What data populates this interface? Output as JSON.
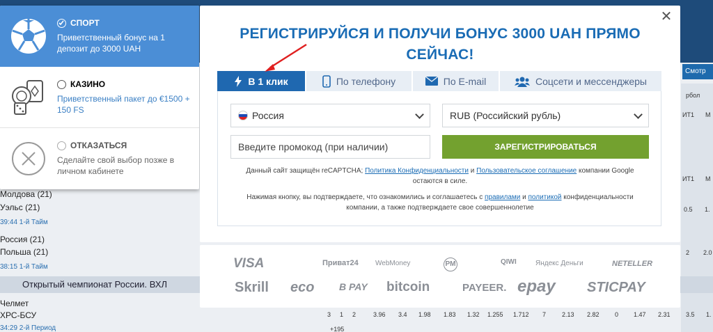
{
  "background": {
    "right_tab": "Смотр",
    "rows": [
      {
        "team": "Молдова (21)"
      },
      {
        "team": "Уэльс (21)"
      },
      {
        "time": "39:44 1-й Тайм"
      },
      {
        "team": "Россия (21)"
      },
      {
        "team": "Польша (21)"
      },
      {
        "time": "38:15 1-й Тайм"
      },
      {
        "league": "Открытый чемпионат России. ВХЛ"
      },
      {
        "team": "Челмет"
      },
      {
        "team": "ХРС-БСУ"
      },
      {
        "time": "34:29 2-й Период"
      }
    ],
    "odds": [
      "3",
      "1",
      "2",
      "3.96",
      "3.4",
      "1.98",
      "1.83",
      "1.32",
      "1.255",
      "1.712",
      "7",
      "2.13",
      "2.82",
      "0",
      "1.47",
      "2.31",
      "3.5",
      "1."
    ],
    "more": "+195",
    "col_labels": [
      "ИТ1",
      "М",
      "ИТ1",
      "М",
      "ИТ1",
      "М",
      "рбол"
    ],
    "side_vals": [
      "0.5",
      "1.",
      "2",
      "2.0"
    ]
  },
  "bonus_panel": {
    "options": [
      {
        "title": "СПОРТ",
        "desc": "Приветственный бонус на 1 депозит до 3000 UAH",
        "selected": true
      },
      {
        "title": "КАЗИНО",
        "desc": "Приветственный пакет до €1500 + 150 FS",
        "selected": false
      },
      {
        "title": "ОТКАЗАТЬСЯ",
        "desc": "Сделайте свой выбор позже в личном кабинете",
        "selected": false
      }
    ]
  },
  "modal": {
    "headline": "РЕГИСТРИРУЙСЯ И ПОЛУЧИ БОНУС 3000 UAH ПРЯМО СЕЙЧАС!",
    "tabs": [
      {
        "label": "В 1 клик",
        "icon": "lightning-icon",
        "active": true
      },
      {
        "label": "По телефону",
        "icon": "phone-icon"
      },
      {
        "label": "По E-mail",
        "icon": "envelope-icon"
      },
      {
        "label": "Соцсети и мессенджеры",
        "icon": "people-icon"
      }
    ],
    "country": "Россия",
    "currency": "RUB (Российский рубль)",
    "promo_placeholder": "Введите промокод (при наличии)",
    "submit": "ЗАРЕГИСТРИРОВАТЬСЯ",
    "note1_a": "Данный сайт защищён reCAPTCHA; ",
    "note1_link1": "Политика Конфиденциальности",
    "note1_b": " и ",
    "note1_link2": "Пользовательское соглашение",
    "note1_c": " компании Google остаются в силе.",
    "note2_a": "Нажимая кнопку, вы подтверждаете, что ознакомились и соглашаетесь с ",
    "note2_link1": "правилами",
    "note2_b": " и ",
    "note2_link2": "политикой",
    "note2_c": " конфиденциальности компании, а также подтверждаете свое совершеннолетие"
  },
  "payments": [
    "VISA",
    "Приват24",
    "WebMoney",
    "PM",
    "QIWI",
    "Яндекс Деньги",
    "NETELLER",
    "Skrill",
    "eco",
    "B PAY",
    "bitcoin",
    "PAYEER.",
    "epay",
    "STICPAY"
  ],
  "colors": {
    "brand_blue": "#1a6cb5",
    "sport_blue": "#4b8ed6",
    "green": "#73a12f",
    "arrow_red": "#e02020"
  }
}
